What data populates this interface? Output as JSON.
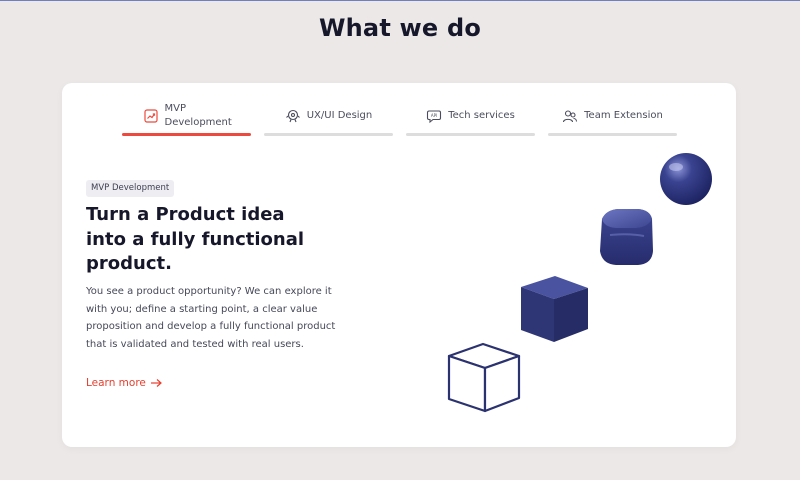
{
  "page": {
    "title": "What we do"
  },
  "tabs": [
    {
      "label": "MVP Development",
      "icon": "chart-icon",
      "active": true
    },
    {
      "label": "UX/UI Design",
      "icon": "design-icon",
      "active": false
    },
    {
      "label": "Tech services",
      "icon": "api-icon",
      "active": false
    },
    {
      "label": "Team Extension",
      "icon": "team-icon",
      "active": false
    }
  ],
  "content": {
    "tag": "MVP Development",
    "headline": "Turn a Product idea into a fully functional product.",
    "description": "You see a product opportunity? We can explore it with you; define a starting point, a clear value proposition and develop a fully functional product that is validated and tested with real users.",
    "link_label": "Learn more"
  },
  "colors": {
    "accent": "#ec4a3e",
    "navy": "#2b3270",
    "background": "#ebe8e7"
  }
}
